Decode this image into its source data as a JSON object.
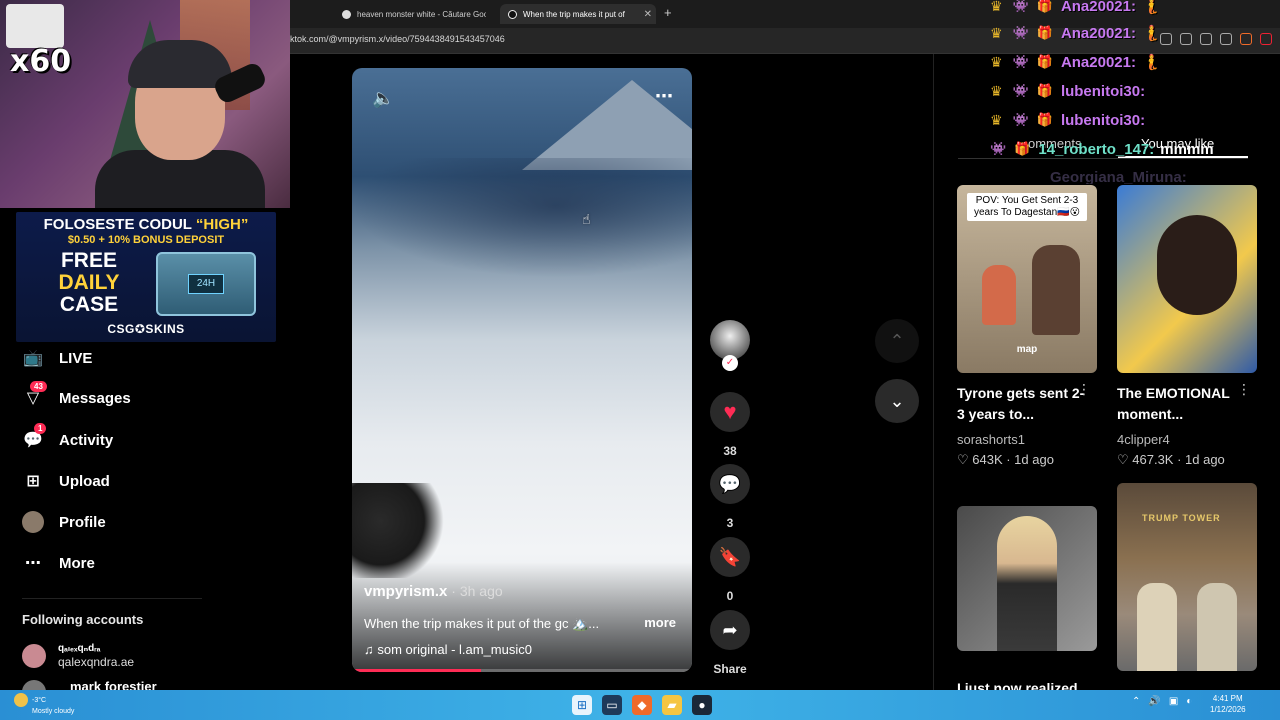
{
  "browser": {
    "tabs": [
      {
        "label": "heaven monster white - Căutare Goo"
      },
      {
        "label": "When the trip makes it put of"
      }
    ],
    "url": "ktok.com/@vmpyrism.x/video/7594438491543457046"
  },
  "webcam": {
    "overlay_text": "x60"
  },
  "ad": {
    "line1_prefix": "FOLOSESTE CODUL ",
    "line1_code": "“HIGH”",
    "line2": "$0.50 + 10% BONUS DEPOSIT",
    "free": "FREE",
    "daily": "DAILY",
    "case": "CASE",
    "chest_tag": "24H",
    "brand": "CSG✪SKINS"
  },
  "sidebar": {
    "items": [
      {
        "label": "LIVE",
        "icon": "live-icon",
        "badge": ""
      },
      {
        "label": "Messages",
        "icon": "messages-icon",
        "badge": "43"
      },
      {
        "label": "Activity",
        "icon": "activity-icon",
        "badge": "1"
      },
      {
        "label": "Upload",
        "icon": "upload-icon",
        "badge": ""
      },
      {
        "label": "Profile",
        "icon": "profile-avatar",
        "badge": ""
      },
      {
        "label": "More",
        "icon": "more-icon",
        "badge": ""
      }
    ],
    "following_title": "Following accounts",
    "accounts": [
      {
        "display": "qₐₗₑₓqₙdᵣₐ",
        "handle": "qalexqndra.ae"
      },
      {
        "display": "mark forestier",
        "handle": ""
      }
    ]
  },
  "video": {
    "author": "vmpyrism.x",
    "time": " · 3h ago",
    "caption": "When the trip makes it put of the gc 🏔️...",
    "more_label": "more",
    "music": "som original - l.am_music0",
    "progress": 0.38
  },
  "actions": {
    "likes": "38",
    "comments": "3",
    "saves": "0",
    "share_label": "Share"
  },
  "right_panel": {
    "tab_comments": "omments",
    "tab_you_may_like": "You may like"
  },
  "chat": [
    {
      "name": "Ana20021:",
      "msg": "🧜",
      "color": "purple"
    },
    {
      "name": "Ana20021:",
      "msg": "🧜",
      "color": "purple"
    },
    {
      "name": "Ana20021:",
      "msg": "🧜",
      "color": "purple"
    },
    {
      "name": "lubenitoi30:",
      "msg": "",
      "color": "purple"
    },
    {
      "name": "lubenitoi30:",
      "msg": "",
      "color": "purple"
    },
    {
      "name": "14_roberto_147:",
      "msg": "mmmm",
      "color": "cyan"
    },
    {
      "name": "Georgiana_Miruna:",
      "msg": "",
      "color": "ghost"
    }
  ],
  "cards": [
    {
      "pov": "POV: You Get Sent 2-3 years To Dagestan🇷🇺😮",
      "overlay": "map",
      "title": "Tyrone gets sent 2-3 years to...",
      "author": "sorashorts1",
      "stats": "♡ 643K · 1d ago"
    },
    {
      "title": "The EMOTIONAL moment...",
      "author": "4clipper4",
      "stats": "♡ 467.3K · 1d ago"
    },
    {
      "title": "",
      "author": "",
      "stats": ""
    },
    {
      "sign": "TRUMP TOWER",
      "title": "",
      "author": "",
      "stats": ""
    }
  ],
  "cut_title": "I just now realized",
  "taskbar": {
    "temp": "-3°C",
    "weather": "Mostly cloudy",
    "time": "4:41 PM",
    "date": "1/12/2026"
  }
}
